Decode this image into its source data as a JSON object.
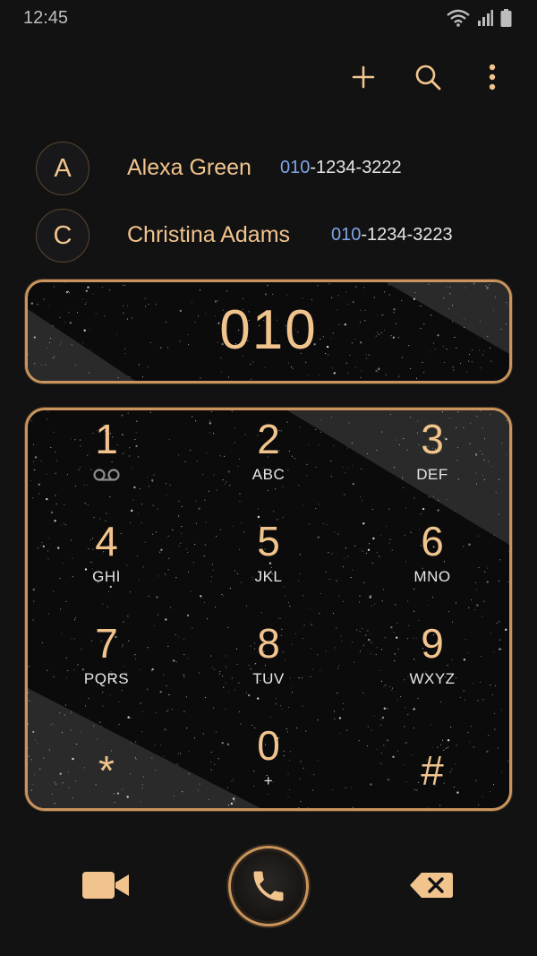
{
  "status_bar": {
    "time": "12:45"
  },
  "toolbar": {
    "add_icon": "plus-icon",
    "search_icon": "search-icon",
    "more_icon": "more-vert-icon"
  },
  "contacts": [
    {
      "initial": "A",
      "name": "Alexa Green",
      "number_match": "010",
      "number_rest": "-1234-3222"
    },
    {
      "initial": "C",
      "name": "Christina Adams",
      "number_match": "010",
      "number_rest": "-1234-3223"
    }
  ],
  "dialer": {
    "number": "010"
  },
  "keypad": {
    "keys": [
      {
        "digit": "1",
        "letters": "",
        "sub_icon": "voicemail-icon"
      },
      {
        "digit": "2",
        "letters": "ABC"
      },
      {
        "digit": "3",
        "letters": "DEF"
      },
      {
        "digit": "4",
        "letters": "GHI"
      },
      {
        "digit": "5",
        "letters": "JKL"
      },
      {
        "digit": "6",
        "letters": "MNO"
      },
      {
        "digit": "7",
        "letters": "PQRS"
      },
      {
        "digit": "8",
        "letters": "TUV"
      },
      {
        "digit": "9",
        "letters": "WXYZ"
      },
      {
        "digit": "*",
        "letters": ""
      },
      {
        "digit": "0",
        "letters": "+"
      },
      {
        "digit": "#",
        "letters": ""
      }
    ]
  },
  "actions": {
    "video_icon": "video-call-icon",
    "call_icon": "phone-icon",
    "backspace_icon": "backspace-icon"
  },
  "colors": {
    "accent": "#f2c48d",
    "frame": "#c9955d",
    "number_highlight": "#7fa6e6",
    "background": "#121213"
  }
}
